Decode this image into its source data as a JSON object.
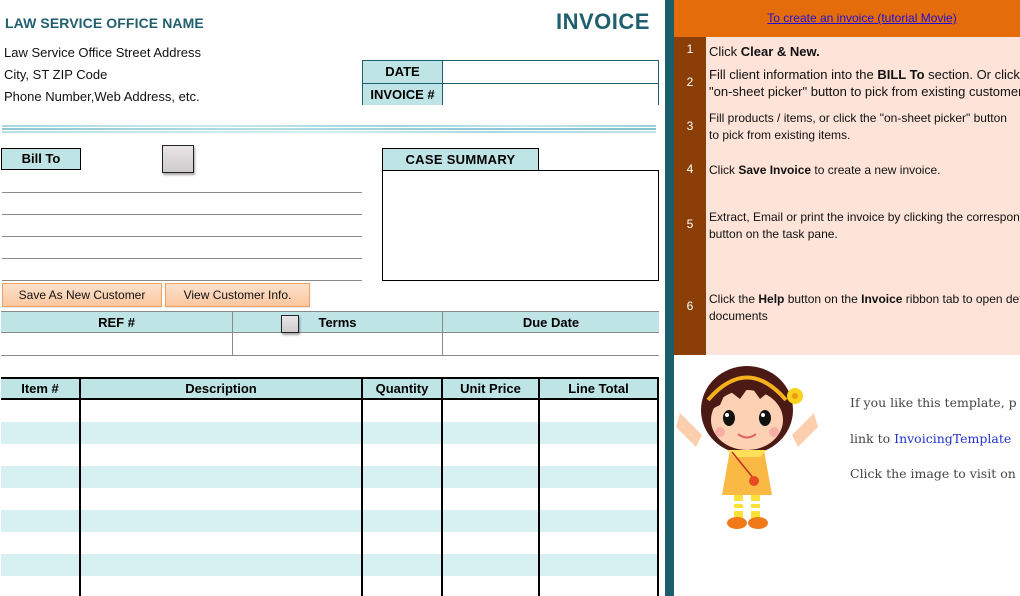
{
  "header": {
    "company_name": "LAW SERVICE OFFICE NAME",
    "title": "INVOICE",
    "address_lines": [
      "Law Service Office Street Address",
      "City, ST  ZIP Code",
      "Phone Number,Web Address, etc."
    ]
  },
  "meta": {
    "date_label": "DATE",
    "date_value": "",
    "invoice_label": "INVOICE #",
    "invoice_value": ""
  },
  "bill_to": {
    "label": "Bill To",
    "picker_icon": "on-sheet-picker-button",
    "lines": [
      "",
      "",
      "",
      "",
      ""
    ]
  },
  "case_summary": {
    "label": "CASE SUMMARY",
    "value": ""
  },
  "buttons": {
    "save_customer": "Save As New Customer",
    "view_customer": "View Customer Info."
  },
  "ref_table": {
    "headers": [
      "REF #",
      "Terms",
      "Due Date"
    ],
    "values": [
      "",
      "",
      ""
    ]
  },
  "items_table": {
    "headers": [
      "Item #",
      "Description",
      "Quantity",
      "Unit Price",
      "Line Total"
    ],
    "rows": [
      [
        "",
        "",
        "",
        "",
        ""
      ],
      [
        "",
        "",
        "",
        "",
        ""
      ],
      [
        "",
        "",
        "",
        "",
        ""
      ],
      [
        "",
        "",
        "",
        "",
        ""
      ],
      [
        "",
        "",
        "",
        "",
        ""
      ],
      [
        "",
        "",
        "",
        "",
        ""
      ],
      [
        "",
        "",
        "",
        "",
        ""
      ],
      [
        "",
        "",
        "",
        "",
        ""
      ],
      [
        "",
        "",
        "",
        "",
        ""
      ]
    ]
  },
  "side_pane": {
    "tutorial_link": "To create an invoice (tutorial Movie)",
    "steps": [
      {
        "num": "1",
        "html": "Click <b>Clear &amp; New.</b>"
      },
      {
        "num": "2",
        "html": "Fill client information into the <b>BILL To</b> section. Or click the<br>\"on-sheet picker\" button to pick from existing customers."
      },
      {
        "num": "3",
        "html": "Fill products / items, or click the \"on-sheet picker\" button<br>to pick from existing items."
      },
      {
        "num": "4",
        "html": "Click <b>Save Invoice</b> to create a new invoice."
      },
      {
        "num": "5",
        "html": "Extract, Email or print the invoice by clicking the corresponding<br>button on the task pane."
      },
      {
        "num": "6",
        "html": "Click the <b>Help</b> button on the <b>Invoice</b> ribbon tab to open detailed<br>documents"
      }
    ],
    "promo": {
      "line1": "If you like this template, p",
      "line2_prefix": "link to ",
      "line2_link": "InvoicingTemplate",
      "line3": "Click the image to visit on"
    }
  },
  "colors": {
    "brand_teal": "#1f5f6e",
    "header_fill": "#bfe4e6",
    "row_alt": "#d7f0f2",
    "tutorial_orange": "#e46c0a",
    "step_brown": "#8b3f06",
    "step_bg": "#fde3d8",
    "button_orange": "#fbc79f"
  }
}
